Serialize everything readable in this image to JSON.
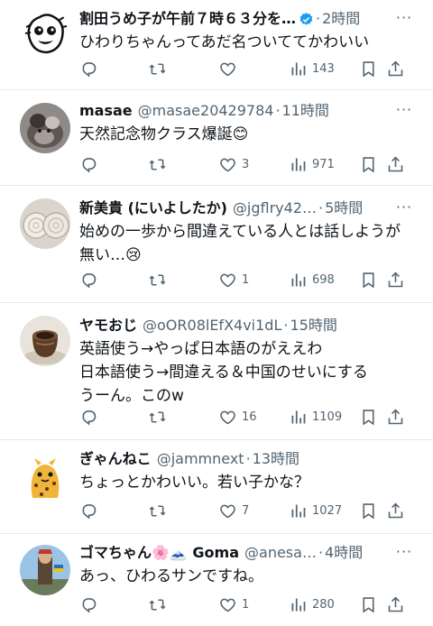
{
  "tweets": [
    {
      "avatar": "doodle-face-avatar",
      "name": "割田うめ子が午前７時６３分を…",
      "handle": "",
      "time": "2時間",
      "verified": true,
      "badge": "",
      "text": [
        "ひわりちゃんってあだ名ついててかわいい"
      ],
      "counts": {
        "reply": "",
        "retweet": "",
        "like": "",
        "views": "143"
      }
    },
    {
      "avatar": "cat-photo-avatar",
      "name": "masae",
      "handle": "@masae20429784",
      "time": "11時間",
      "verified": false,
      "badge": "",
      "text": [
        "天然記念物クラス爆誕😊"
      ],
      "counts": {
        "reply": "",
        "retweet": "",
        "like": "3",
        "views": "971"
      }
    },
    {
      "avatar": "shells-photo-avatar",
      "name": "新美貴 (にいよしたか)",
      "handle": "@jgflry42…",
      "time": "5時間",
      "verified": false,
      "badge": "",
      "text": [
        "始めの一歩から間違えている人とは話しようが",
        "無い…😢"
      ],
      "counts": {
        "reply": "",
        "retweet": "",
        "like": "1",
        "views": "698"
      }
    },
    {
      "avatar": "pottery-photo-avatar",
      "name": "ヤモおじ",
      "handle": "@oOR08lEfX4vi1dL",
      "time": "15時間",
      "verified": false,
      "badge": "",
      "text": [
        "英語使う→やっぱ日本語のがええわ",
        "日本語使う→間違える＆中国のせいにする",
        "うーん。このw"
      ],
      "counts": {
        "reply": "",
        "retweet": "",
        "like": "16",
        "views": "1109"
      }
    },
    {
      "avatar": "cheetah-illustration-avatar",
      "name": "ぎゃんねこ",
      "handle": "@jammnext",
      "time": "13時間",
      "verified": false,
      "badge": "",
      "text": [
        "ちょっとかわいい。若い子かな？"
      ],
      "counts": {
        "reply": "",
        "retweet": "",
        "like": "7",
        "views": "1027"
      }
    },
    {
      "avatar": "warrior-illustration-avatar",
      "name": "ゴマちゃん🌸🗻 Goma",
      "handle": "@anesa…",
      "time": "4時間",
      "verified": false,
      "badge": "",
      "text": [
        "あっ、ひわるサンですね。"
      ],
      "counts": {
        "reply": "",
        "retweet": "",
        "like": "1",
        "views": "280"
      }
    }
  ],
  "ui": {
    "dot": "·",
    "more": "···"
  },
  "colors": {
    "text": "#0f1419",
    "secondary": "#536471",
    "verified": "#1d9bf0",
    "divider": "#e6e8ea"
  },
  "icons": [
    "reply-icon",
    "retweet-icon",
    "like-icon",
    "views-icon",
    "bookmark-icon",
    "share-icon",
    "verified-icon",
    "more-icon"
  ]
}
